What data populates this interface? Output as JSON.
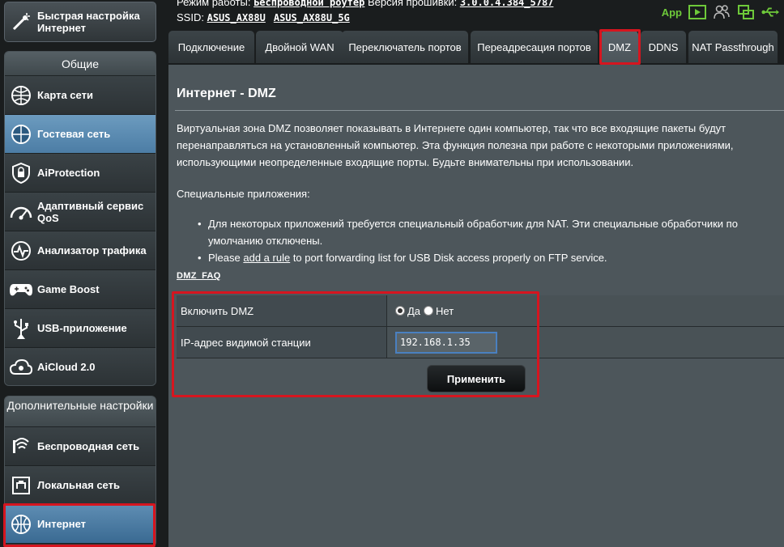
{
  "status": {
    "mode_label": "Режим работы:",
    "mode_value": "Беспроводной роутер",
    "firmware_label": "Версия прошивки:",
    "firmware_value": "3.0.0.4.384_5787",
    "ssid_label": "SSID:",
    "ssid_1": "ASUS_AX88U",
    "ssid_2": "ASUS_AX88U_5G",
    "app_label": "App",
    "icons": [
      "play-icon",
      "users-icon",
      "windows-icon",
      "usb-icon"
    ]
  },
  "sidebar": {
    "quick_setup": "Быстрая настройка Интернет",
    "general_title": "Общие",
    "general_items": [
      {
        "label": "Карта сети",
        "icon": "network-map-icon"
      },
      {
        "label": "Гостевая сеть",
        "icon": "guest-network-icon"
      },
      {
        "label": "AiProtection",
        "icon": "shield-icon"
      },
      {
        "label": "Адаптивный сервис QoS",
        "icon": "gauge-icon"
      },
      {
        "label": "Анализатор трафика",
        "icon": "traffic-analyzer-icon"
      },
      {
        "label": "Game Boost",
        "icon": "gamepad-icon"
      },
      {
        "label": "USB-приложение",
        "icon": "usb-icon"
      },
      {
        "label": "AiCloud 2.0",
        "icon": "cloud-icon"
      }
    ],
    "advanced_title": "Дополнительные настройки",
    "advanced_items": [
      {
        "label": "Беспроводная сеть",
        "icon": "wifi-icon"
      },
      {
        "label": "Локальная сеть",
        "icon": "lan-icon"
      },
      {
        "label": "Интернет",
        "icon": "globe-icon"
      }
    ]
  },
  "tabs": [
    {
      "label": "Подключение"
    },
    {
      "label": "Двойной WAN"
    },
    {
      "label": "Переключатель портов"
    },
    {
      "label": "Переадресация портов"
    },
    {
      "label": "DMZ"
    },
    {
      "label": "DDNS"
    },
    {
      "label": "NAT Passthrough"
    }
  ],
  "main": {
    "title": "Интернет - DMZ",
    "description": "Виртуальная зона DMZ позволяет показывать в Интернете один компьютер, так что все входящие пакеты будут перенаправляться на установленный компьютер. Эта функция полезна при работе с некоторыми приложениями, использующими неопределенные входящие порты. Будьте внимательны при использовании.",
    "special_title": "Специальные приложения:",
    "bullet_1": "Для некоторых приложений требуется специальный обработчик для NAT. Эти специальные обработчики по умолчанию отключены.",
    "bullet_2_pre": "Please ",
    "bullet_2_link": "add a rule",
    "bullet_2_post": " to port forwarding list for USB Disk access properly on FTP service.",
    "faq": "DMZ_FAQ",
    "enable_label": "Включить DMZ",
    "yes": "Да",
    "no": "Нет",
    "ip_label": "IP-адрес видимой станции",
    "ip_value": "192.168.1.35",
    "apply": "Применить"
  }
}
